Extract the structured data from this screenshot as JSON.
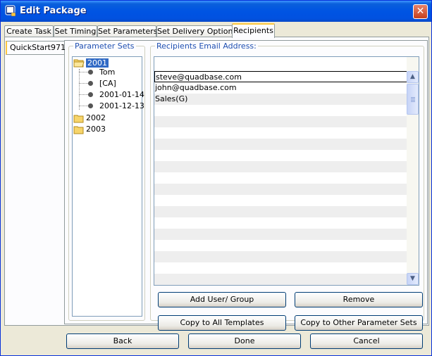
{
  "window": {
    "title": "Edit Package",
    "close": "✕"
  },
  "tabs": [
    "Create Task",
    "Set Timing",
    "Set Parameters",
    "Set Delivery Options",
    "Recipients"
  ],
  "active_tab": "Recipients",
  "side_tab": "QuickStart971",
  "parameter_sets": {
    "label": "Parameter Sets",
    "tree": [
      {
        "label": "2001",
        "expanded": true,
        "selected": true,
        "children": [
          "Tom",
          "[CA]",
          "2001-01-14",
          "2001-12-13"
        ]
      },
      {
        "label": "2002"
      },
      {
        "label": "2003"
      }
    ]
  },
  "recipients": {
    "label": "Recipients Email Address:",
    "items": [
      "steve@quadbase.com",
      "john@quadbase.com",
      "Sales(G)"
    ]
  },
  "buttons": {
    "add_user_group": "Add User/ Group",
    "remove": "Remove",
    "copy_all_templates": "Copy to All Templates",
    "copy_other_params": "Copy to Other Parameter Sets",
    "back": "Back",
    "done": "Done",
    "cancel": "Cancel"
  }
}
